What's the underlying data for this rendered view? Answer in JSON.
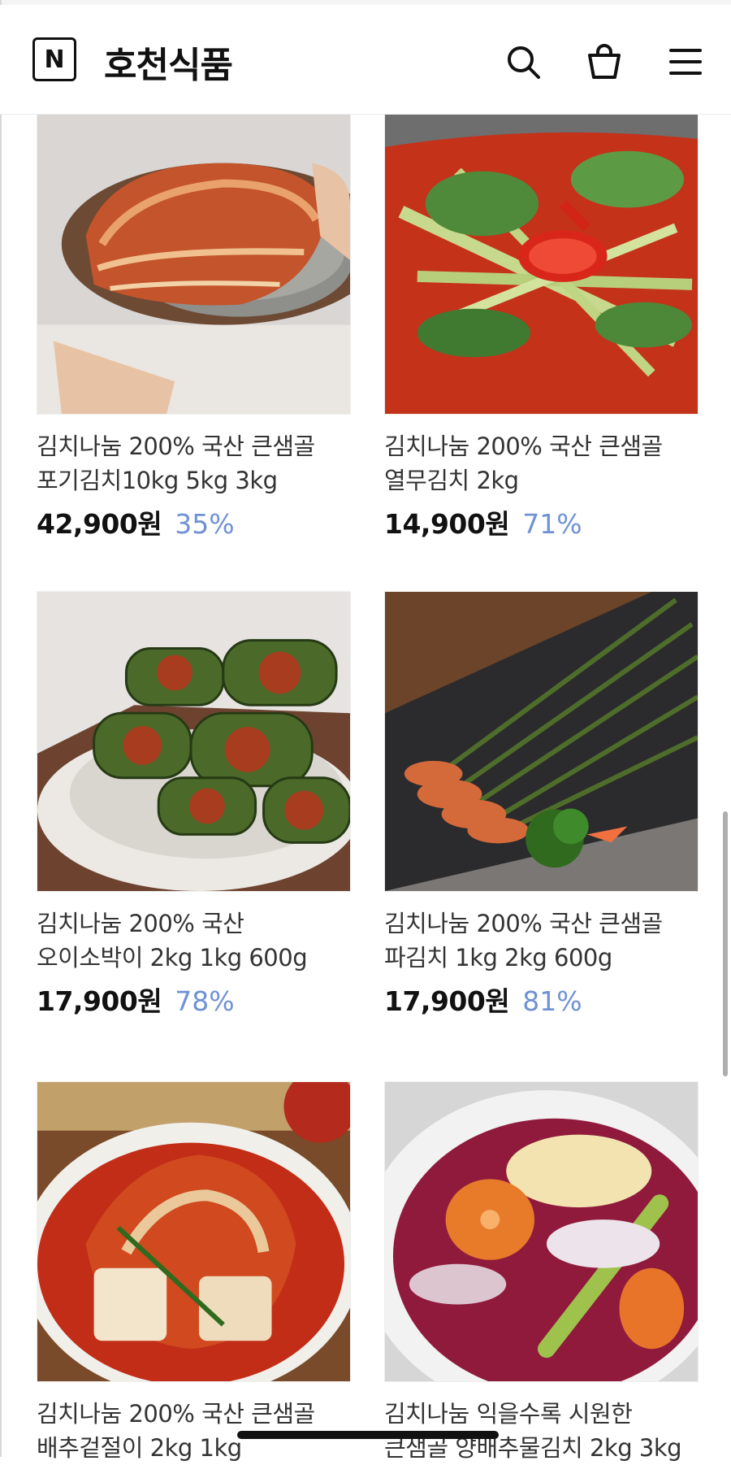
{
  "header": {
    "logo_letter": "N",
    "store_name": "호천식품",
    "icons": [
      "search-icon",
      "shopping-bag-icon",
      "menu-icon"
    ]
  },
  "products": [
    {
      "name": "김치나눔 200% 국산 큰샘골 포기김치10kg 5kg 3kg",
      "price": "42,900원",
      "discount": "35%"
    },
    {
      "name": "김치나눔 200% 국산 큰샘골 열무김치 2kg",
      "price": "14,900원",
      "discount": "71%"
    },
    {
      "name": "김치나눔 200% 국산 오이소박이 2kg 1kg 600g",
      "price": "17,900원",
      "discount": "78%"
    },
    {
      "name": "김치나눔 200% 국산 큰샘골 파김치 1kg 2kg 600g",
      "price": "17,900원",
      "discount": "81%"
    },
    {
      "name": "김치나눔 200% 국산 큰샘골 배추겉절이 2kg 1kg",
      "price": "",
      "discount": ""
    },
    {
      "name": "김치나눔 익을수록 시원한 큰샘골 양배추물김치 2kg 3kg",
      "price": "",
      "discount": ""
    }
  ],
  "colors": {
    "discount": "#6f91d6",
    "price": "#111111",
    "text": "#333333"
  }
}
